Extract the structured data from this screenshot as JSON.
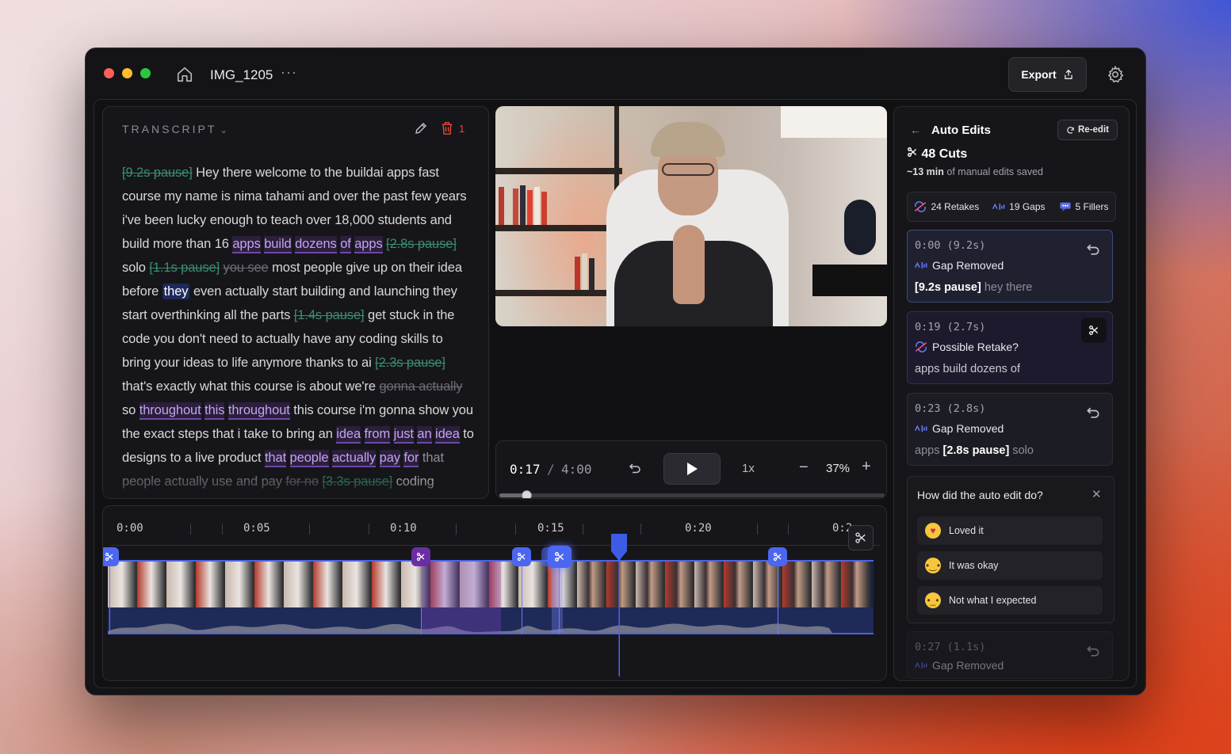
{
  "window": {
    "file_title": "IMG_1205",
    "more_label": "···",
    "export_label": "Export"
  },
  "transcript": {
    "header": "TRANSCRIPT",
    "deleted_count": "1"
  },
  "player": {
    "current_time": "0:17",
    "separator": "/",
    "total_time": "4:00",
    "speed": "1x",
    "zoom": "37%",
    "progress": 0.07
  },
  "timeline": {
    "ticks": [
      "0:00",
      "0:05",
      "0:10",
      "0:15",
      "0:20",
      "0:2"
    ]
  },
  "auto_edits": {
    "back_label": "←",
    "title": "Auto Edits",
    "reedit_label": "Re-edit",
    "cuts_label": "48 Cuts",
    "saved_amount": "~13 min",
    "saved_suffix": "of manual edits saved",
    "stats": {
      "retakes": "24 Retakes",
      "gaps": "19 Gaps",
      "fillers": "5 Fillers"
    },
    "cards": [
      {
        "time": "0:00 (9.2s)",
        "type": "Gap Removed",
        "pre": "",
        "bold": "[9.2s pause]",
        "post": "hey there"
      },
      {
        "time": "0:19 (2.7s)",
        "type": "Possible Retake?",
        "text": "apps build dozens of"
      },
      {
        "time": "0:23 (2.8s)",
        "type": "Gap Removed",
        "pre": "apps",
        "bold": "[2.8s pause]",
        "post": "solo"
      },
      {
        "time": "0:27 (1.1s)",
        "type": "Gap Removed"
      }
    ],
    "feedback": {
      "question": "How did the auto edit do?",
      "close": "✕",
      "options": [
        "Loved it",
        "It was okay",
        "Not what I expected"
      ]
    }
  },
  "colors": {
    "accent_blue": "#4b66f0",
    "retake_purple": "#6a2ea2",
    "pause_green": "#3b8c74",
    "delete_red": "#e5453a"
  }
}
